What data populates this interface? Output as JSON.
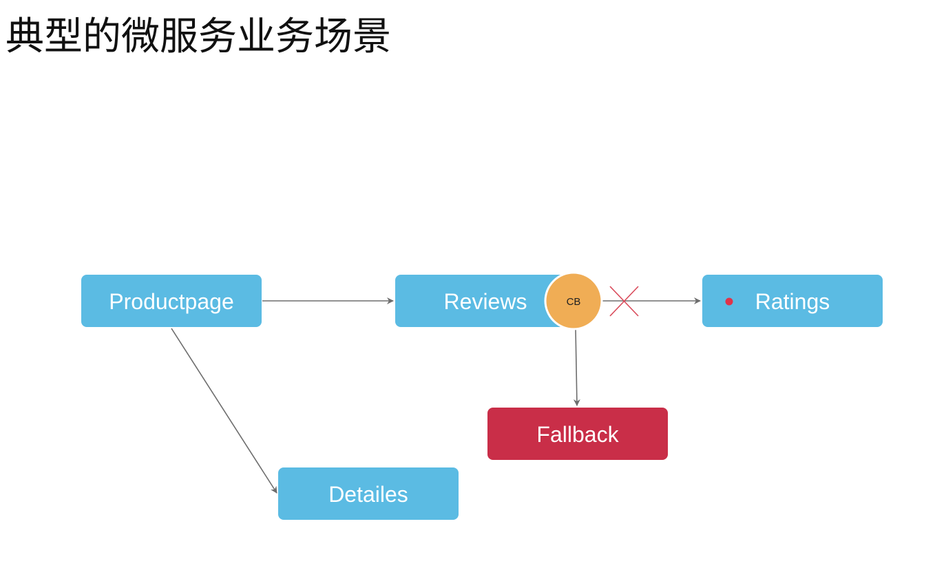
{
  "title": "典型的微服务业务场景",
  "colors": {
    "service": "#5bbbe3",
    "fallback": "#c92e48",
    "circuit_breaker": "#f0ad55",
    "edge": "#6d6d6d",
    "broken_mark": "#d94a5a",
    "status_dot": "#e0334a"
  },
  "nodes": {
    "productpage": "Productpage",
    "reviews": "Reviews",
    "ratings": "Ratings",
    "fallback": "Fallback",
    "details": "Detailes",
    "circuit_breaker": "CB"
  },
  "edges": [
    {
      "from": "Productpage",
      "to": "Reviews",
      "state": "ok"
    },
    {
      "from": "Productpage",
      "to": "Detailes",
      "state": "ok"
    },
    {
      "from": "CB",
      "to": "Ratings",
      "state": "broken"
    },
    {
      "from": "CB",
      "to": "Fallback",
      "state": "ok"
    }
  ]
}
